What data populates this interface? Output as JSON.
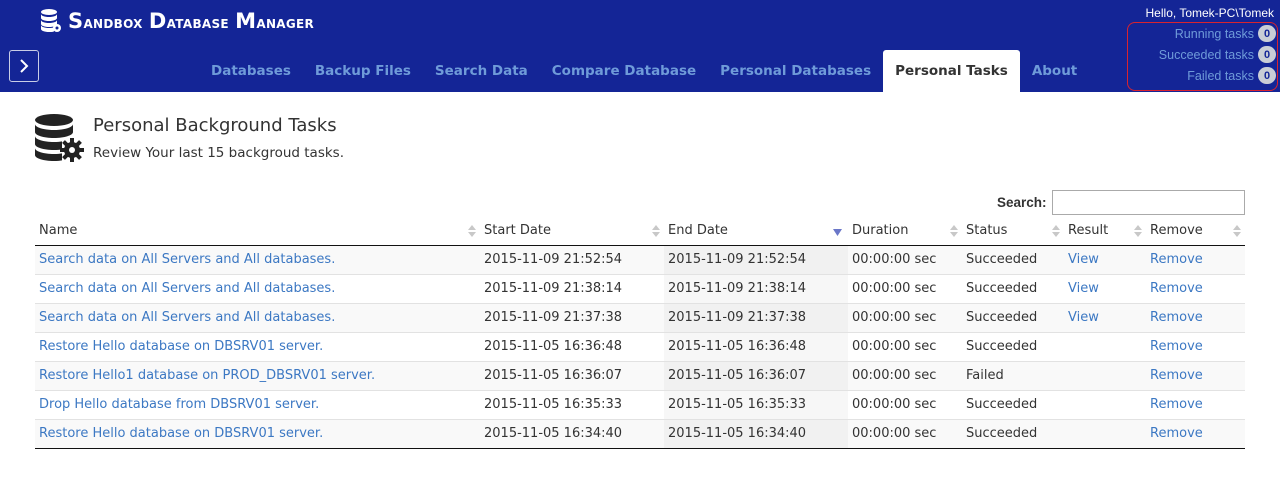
{
  "app": {
    "title_first": "S",
    "title_word1": "andbox ",
    "title_d": "D",
    "title_word2": "atabase ",
    "title_m": "M",
    "title_word3": "anager"
  },
  "nav": {
    "items": [
      {
        "label": "Databases"
      },
      {
        "label": "Backup Files"
      },
      {
        "label": "Search Data"
      },
      {
        "label": "Compare Database"
      },
      {
        "label": "Personal Databases"
      },
      {
        "label": "Personal Tasks"
      },
      {
        "label": "About"
      }
    ],
    "active": "Personal Tasks"
  },
  "user": {
    "greeting": "Hello, Tomek-PC\\Tomek"
  },
  "tasks": {
    "running_label": "Running tasks",
    "running_count": "0",
    "succeeded_label": "Succeeded tasks",
    "succeeded_count": "0",
    "failed_label": "Failed tasks",
    "failed_count": "0"
  },
  "page": {
    "title": "Personal Background Tasks",
    "subtitle": "Review Your last 15 backgroud tasks."
  },
  "search": {
    "label": "Search:",
    "value": ""
  },
  "table": {
    "headers": {
      "name": "Name",
      "start": "Start Date",
      "end": "End Date",
      "duration": "Duration",
      "status": "Status",
      "result": "Result",
      "remove": "Remove"
    },
    "sorted_column": "End Date",
    "sort_direction": "descending",
    "rows": [
      {
        "name": "Search data on All Servers and All databases.",
        "start": "2015-11-09 21:52:54",
        "end": "2015-11-09 21:52:54",
        "duration": "00:00:00 sec",
        "status": "Succeeded",
        "result": "View",
        "remove": "Remove"
      },
      {
        "name": "Search data on All Servers and All databases.",
        "start": "2015-11-09 21:38:14",
        "end": "2015-11-09 21:38:14",
        "duration": "00:00:00 sec",
        "status": "Succeeded",
        "result": "View",
        "remove": "Remove"
      },
      {
        "name": "Search data on All Servers and All databases.",
        "start": "2015-11-09 21:37:38",
        "end": "2015-11-09 21:37:38",
        "duration": "00:00:00 sec",
        "status": "Succeeded",
        "result": "View",
        "remove": "Remove"
      },
      {
        "name": "Restore Hello database on DBSRV01 server.",
        "start": "2015-11-05 16:36:48",
        "end": "2015-11-05 16:36:48",
        "duration": "00:00:00 sec",
        "status": "Succeeded",
        "result": "",
        "remove": "Remove"
      },
      {
        "name": "Restore Hello1 database on PROD_DBSRV01 server.",
        "start": "2015-11-05 16:36:07",
        "end": "2015-11-05 16:36:07",
        "duration": "00:00:00 sec",
        "status": "Failed",
        "result": "",
        "remove": "Remove"
      },
      {
        "name": "Drop Hello database from DBSRV01 server.",
        "start": "2015-11-05 16:35:33",
        "end": "2015-11-05 16:35:33",
        "duration": "00:00:00 sec",
        "status": "Succeeded",
        "result": "",
        "remove": "Remove"
      },
      {
        "name": "Restore Hello database on DBSRV01 server.",
        "start": "2015-11-05 16:34:40",
        "end": "2015-11-05 16:34:40",
        "duration": "00:00:00 sec",
        "status": "Succeeded",
        "result": "",
        "remove": "Remove"
      }
    ]
  },
  "colors": {
    "header_bg": "#142596",
    "link": "#3c78c3",
    "nav_link": "#6f9bd9",
    "highlight_box": "#d9232e"
  }
}
